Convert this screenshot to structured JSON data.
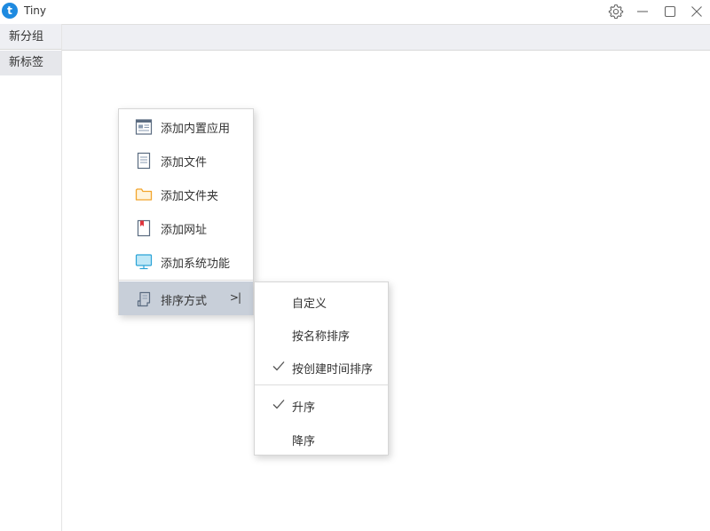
{
  "app": {
    "logo_letter": "t",
    "title": "Tiny",
    "brand_color": "#1e8ae0"
  },
  "titlebar_icons": [
    "gear-icon",
    "minimize-icon",
    "maximize-icon",
    "close-icon"
  ],
  "sidebar": {
    "group_label": "新分组",
    "tab_label": "新标签"
  },
  "context_menu": {
    "items": [
      {
        "label": "添加内置应用",
        "icon": "builtin-app-icon"
      },
      {
        "label": "添加文件",
        "icon": "file-icon"
      },
      {
        "label": "添加文件夹",
        "icon": "folder-icon"
      },
      {
        "label": "添加网址",
        "icon": "bookmark-icon"
      },
      {
        "label": "添加系统功能",
        "icon": "monitor-icon"
      }
    ],
    "sort": {
      "label": "排序方式",
      "icon": "scroll-icon",
      "arrow": ">|"
    }
  },
  "sort_submenu": {
    "items": [
      {
        "label": "自定义",
        "checked": false
      },
      {
        "label": "按名称排序",
        "checked": false
      },
      {
        "label": "按创建时间排序",
        "checked": true
      }
    ],
    "order": [
      {
        "label": "升序",
        "checked": true
      },
      {
        "label": "降序",
        "checked": false
      }
    ]
  }
}
